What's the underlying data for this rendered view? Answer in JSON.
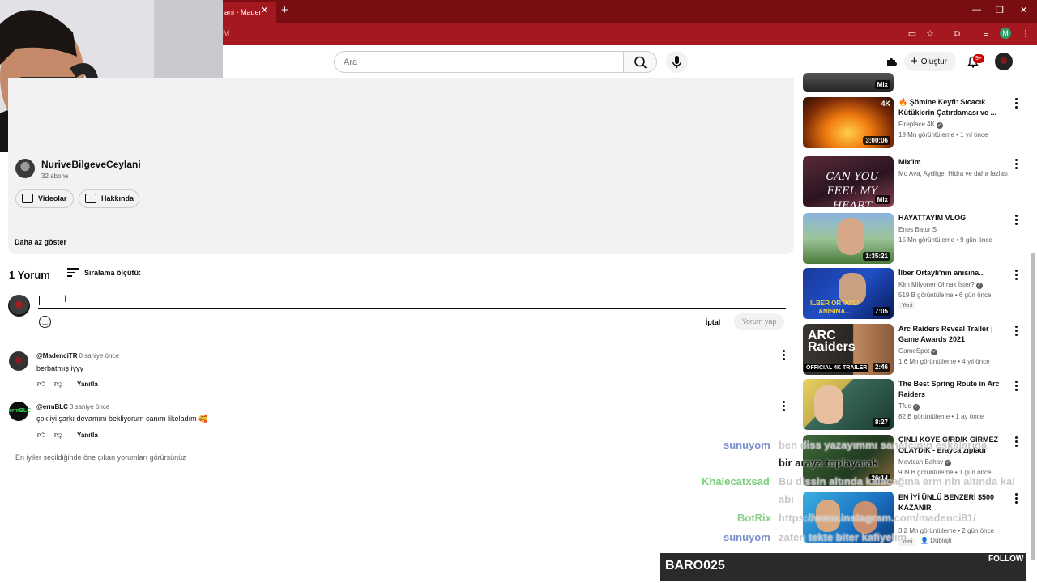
{
  "browser": {
    "tab_title": "ani - Maden",
    "tab_close": "✕",
    "new_tab": "+",
    "address_fragment": "M",
    "profile_initial": "M"
  },
  "header": {
    "search_placeholder": "Ara",
    "create_label": "Oluştur",
    "notification_count": "9+"
  },
  "description": {
    "channel_name": "NuriveBilgeveCeylani",
    "subscribers": "32 abone",
    "videos_button": "Videolar",
    "about_button": "Hakkında",
    "show_less": "Daha az göster"
  },
  "comments": {
    "count_label": "1 Yorum",
    "sort_label": "Sıralama ölçütü:",
    "cancel_label": "İptal",
    "submit_label": "Yorum yap",
    "reply_label": "Yanıtla",
    "items": [
      {
        "author": "@MadenciTR",
        "time": "0 saniye önce",
        "text": "berbatmış iyyy"
      },
      {
        "author": "@ermBLC",
        "time": "3 saniye önce",
        "text": "çok iyi şarkı devamını bekliyorum canım likeladım 🥰"
      }
    ],
    "footnote": "En iyiler seçildiğinde öne çıkan yorumları görürsünüz"
  },
  "sidebar": {
    "top_partial_badge": "Mix",
    "items": [
      {
        "title": "🔥 Şömine Keyfi: Sıcacık Kütüklerin Çatırdaması ve ...",
        "channel": "Fireplace 4K",
        "stats": "19 Mn görüntüleme • 1 yıl önce",
        "duration": "3:00:06",
        "badge": "4K"
      },
      {
        "title": "Mix'im",
        "channel": "Mo Ava, Aydilge, Hidra ve daha fazlası",
        "stats": "",
        "duration": "Mix",
        "overlay_text": "CAN YOU FEEL MY HEART"
      },
      {
        "title": "HAYATTAYIM VLOG",
        "channel": "Enes Batur S",
        "stats": "15 Mn görüntüleme • 9 gün önce",
        "duration": "1:35:21"
      },
      {
        "title": "İlber Ortaylı'nın anısına...",
        "channel": "Kim Milyoner Olmak İster?",
        "stats": "519 B görüntüleme • 6 gün önce",
        "duration": "7:05",
        "new_label": "Yeni",
        "overlay_text": "İLBER ORTAYLI ANISINA..."
      },
      {
        "title": "Arc Raiders Reveal Trailer | Game Awards 2021",
        "channel": "GameSpot",
        "stats": "1,6 Mn görüntüleme • 4 yıl önce",
        "duration": "2:46",
        "overlay_text": "ARC Raiders",
        "overlay_sub": "OFFICIAL 4K TRAILER"
      },
      {
        "title": "The Best Spring Route in Arc Raiders",
        "channel": "Tfue",
        "stats": "82 B görüntüleme • 1 ay önce",
        "duration": "8:27"
      },
      {
        "title": "ÇİNLİ KÖYE GİRDİK GİRMEZ OLAYDIK - Erayca zıpladı",
        "channel": "Mevtcan Bahav",
        "stats": "909 B görüntüleme • 1 gün önce",
        "duration": "26:14"
      },
      {
        "title": "EN İYİ ÜNLÜ BENZERİ $500 KAZANIR",
        "channel": "",
        "stats": "3,2 Mn görüntüleme • 2 gün önce",
        "duration": "",
        "new_label": "Yeni",
        "dubbed": "Dublajlı"
      }
    ]
  },
  "stream_chat": [
    {
      "user": "sunuyom",
      "message": "ben diss yazayımmı sanatçının eşkalarıda"
    },
    {
      "user": "",
      "message": "bir araya toplayarak"
    },
    {
      "user": "Khalecatxsad",
      "message": "Bu dissin altında kalacağına erm nin altında kal"
    },
    {
      "user": "",
      "message": "abi"
    },
    {
      "user": "BotRix",
      "message": "https://www.instagram.com/madenci81/"
    },
    {
      "user": "sunuyom",
      "message": "zaten tekte biter kafiyelim"
    }
  ],
  "follow_bar": {
    "name": "BARO025",
    "label": "FOLLOW"
  },
  "colors": {
    "browser_frame": "#a51820",
    "tab_strip": "#7a0d12",
    "chat_user": "#7a8fcf"
  }
}
